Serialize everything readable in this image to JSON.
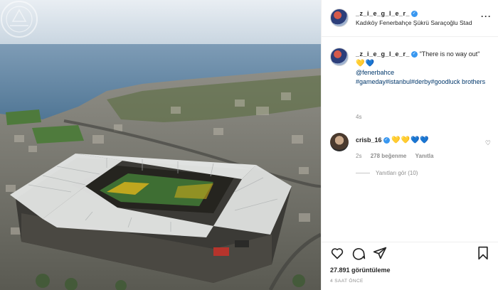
{
  "header": {
    "username": "_z_i_e_g_l_e_r_",
    "verified": true,
    "location": "Kadıköy Fenerbahçe Şükrü Saraçoğlu Stad",
    "more_icon": "more-dots-icon"
  },
  "caption": {
    "username": "_z_i_e_g_l_e_r_",
    "text": "\"There is no way out\"",
    "emojis": "💛💙",
    "mention": "@fenerbahce",
    "hashtags": "#gameday#istanbul#derby#goodluck brothers",
    "time": "4s"
  },
  "comment": {
    "username": "crisb_16",
    "verified": true,
    "text": "💛💛💙💙",
    "time": "2s",
    "likes": "278 beğenme",
    "reply": "Yanıtla",
    "view_replies": "Yanıtları gör (10)"
  },
  "actions": {
    "views": "27.891 görüntüleme",
    "posted": "4 SAAT ÖNCE"
  },
  "colors": {
    "link": "#00376b",
    "muted": "#8e8e8e",
    "verified": "#3897f0"
  }
}
